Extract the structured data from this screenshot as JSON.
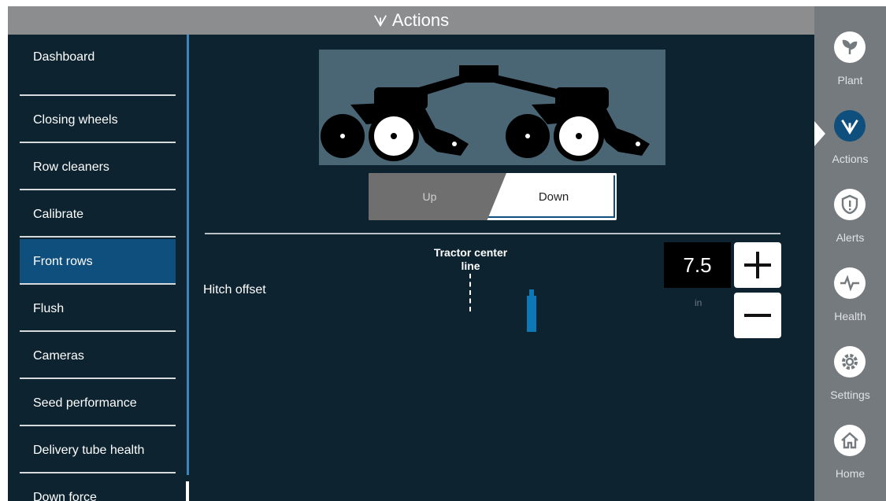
{
  "header": {
    "title": "Actions",
    "icon": "actions-icon"
  },
  "menu": {
    "items": [
      {
        "label": "Dashboard"
      },
      {
        "label": "Closing wheels"
      },
      {
        "label": "Row cleaners"
      },
      {
        "label": "Calibrate"
      },
      {
        "label": "Front rows",
        "active": true
      },
      {
        "label": "Flush"
      },
      {
        "label": "Cameras"
      },
      {
        "label": "Seed performance"
      },
      {
        "label": "Delivery tube health"
      },
      {
        "label": "Down force"
      }
    ]
  },
  "position_toggle": {
    "up_label": "Up",
    "down_label": "Down",
    "selected": "Down"
  },
  "hitch": {
    "label": "Hitch offset",
    "center_label_line1": "Tractor center",
    "center_label_line2": "line",
    "value": "7.5",
    "unit": "in"
  },
  "rightnav": {
    "items": [
      {
        "label": "Plant",
        "icon": "plant-icon"
      },
      {
        "label": "Actions",
        "icon": "actions-icon",
        "active": true
      },
      {
        "label": "Alerts",
        "icon": "alerts-icon"
      },
      {
        "label": "Health",
        "icon": "health-icon"
      },
      {
        "label": "Settings",
        "icon": "settings-icon"
      },
      {
        "label": "Home",
        "icon": "home-icon"
      }
    ]
  },
  "colors": {
    "background": "#0d2330",
    "titlebar": "#8b8d8f",
    "accent": "#0e4f7d",
    "nav_background": "#747a7e",
    "marker": "#0e78b4"
  }
}
